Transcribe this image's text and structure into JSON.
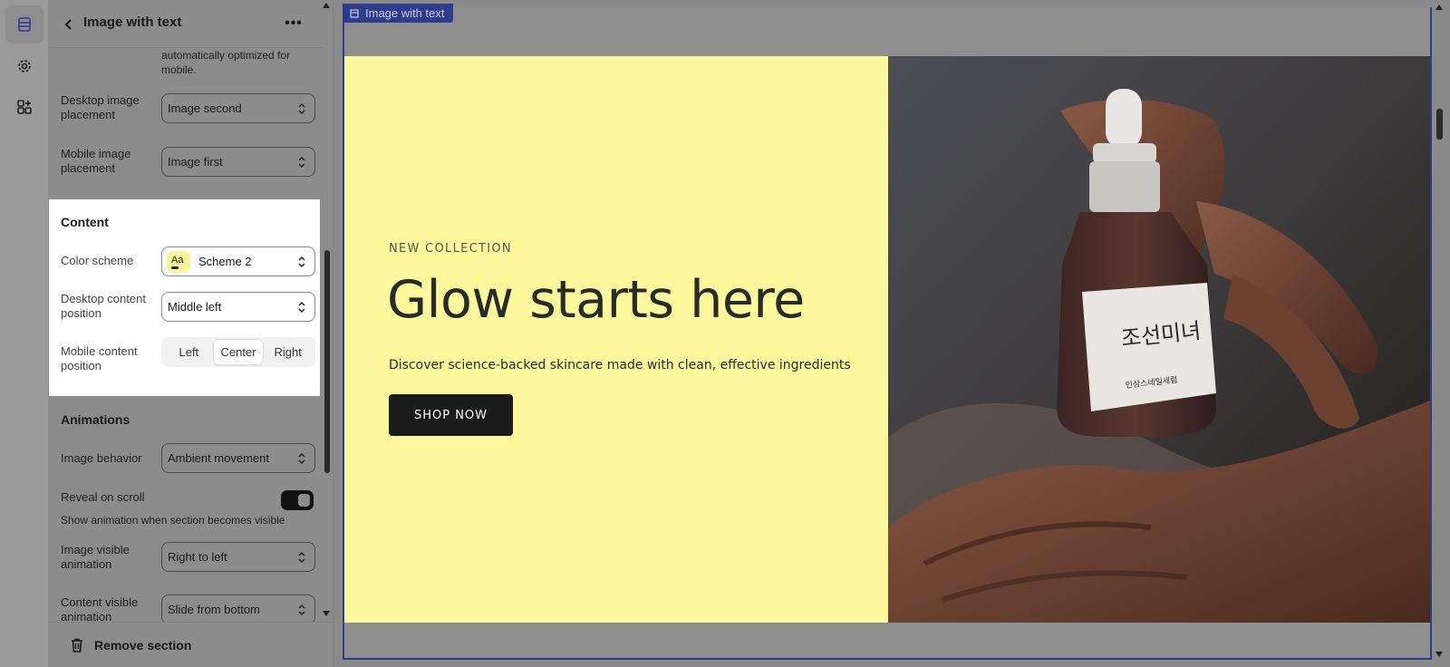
{
  "rail": {
    "items": [
      {
        "icon": "sections-icon",
        "active": true
      },
      {
        "icon": "gear-icon",
        "active": false
      },
      {
        "icon": "apps-icon",
        "active": false
      }
    ]
  },
  "panel": {
    "title": "Image with text",
    "help_text": "automatically optimized for mobile.",
    "desktop_image_placement": {
      "label": "Desktop image placement",
      "value": "Image second"
    },
    "mobile_image_placement": {
      "label": "Mobile image placement",
      "value": "Image first"
    },
    "content": {
      "title": "Content",
      "color_scheme": {
        "label": "Color scheme",
        "value": "Scheme 2",
        "swatch_text": "Aa",
        "swatch_color": "#f9f79a"
      },
      "desktop_content_position": {
        "label": "Desktop content position",
        "value": "Middle left"
      },
      "mobile_content_position": {
        "label": "Mobile content position",
        "options": [
          "Left",
          "Center",
          "Right"
        ],
        "selected": "Center"
      }
    },
    "animations": {
      "title": "Animations",
      "image_behavior": {
        "label": "Image behavior",
        "value": "Ambient movement"
      },
      "reveal_on_scroll": {
        "label": "Reveal on scroll",
        "enabled": true,
        "help": "Show animation when section becomes visible"
      },
      "image_visible_animation": {
        "label": "Image visible animation",
        "value": "Right to left"
      },
      "content_visible_animation": {
        "label": "Content visible animation",
        "value": "Slide from bottom"
      }
    },
    "footer": {
      "remove_label": "Remove section"
    }
  },
  "preview": {
    "section_tag": "Image with text",
    "eyebrow": "NEW COLLECTION",
    "headline": "Glow starts here",
    "subtext": "Discover science-backed skincare made with clean, effective ingredients",
    "cta": "SHOP NOW",
    "bottle_label": "조선미녀",
    "bottle_label_sub": "인삼스네일세럼",
    "colors": {
      "banner_bg": "#fbf99b",
      "accent": "#2d3c8c",
      "cta_bg": "#1c1c1c"
    }
  }
}
